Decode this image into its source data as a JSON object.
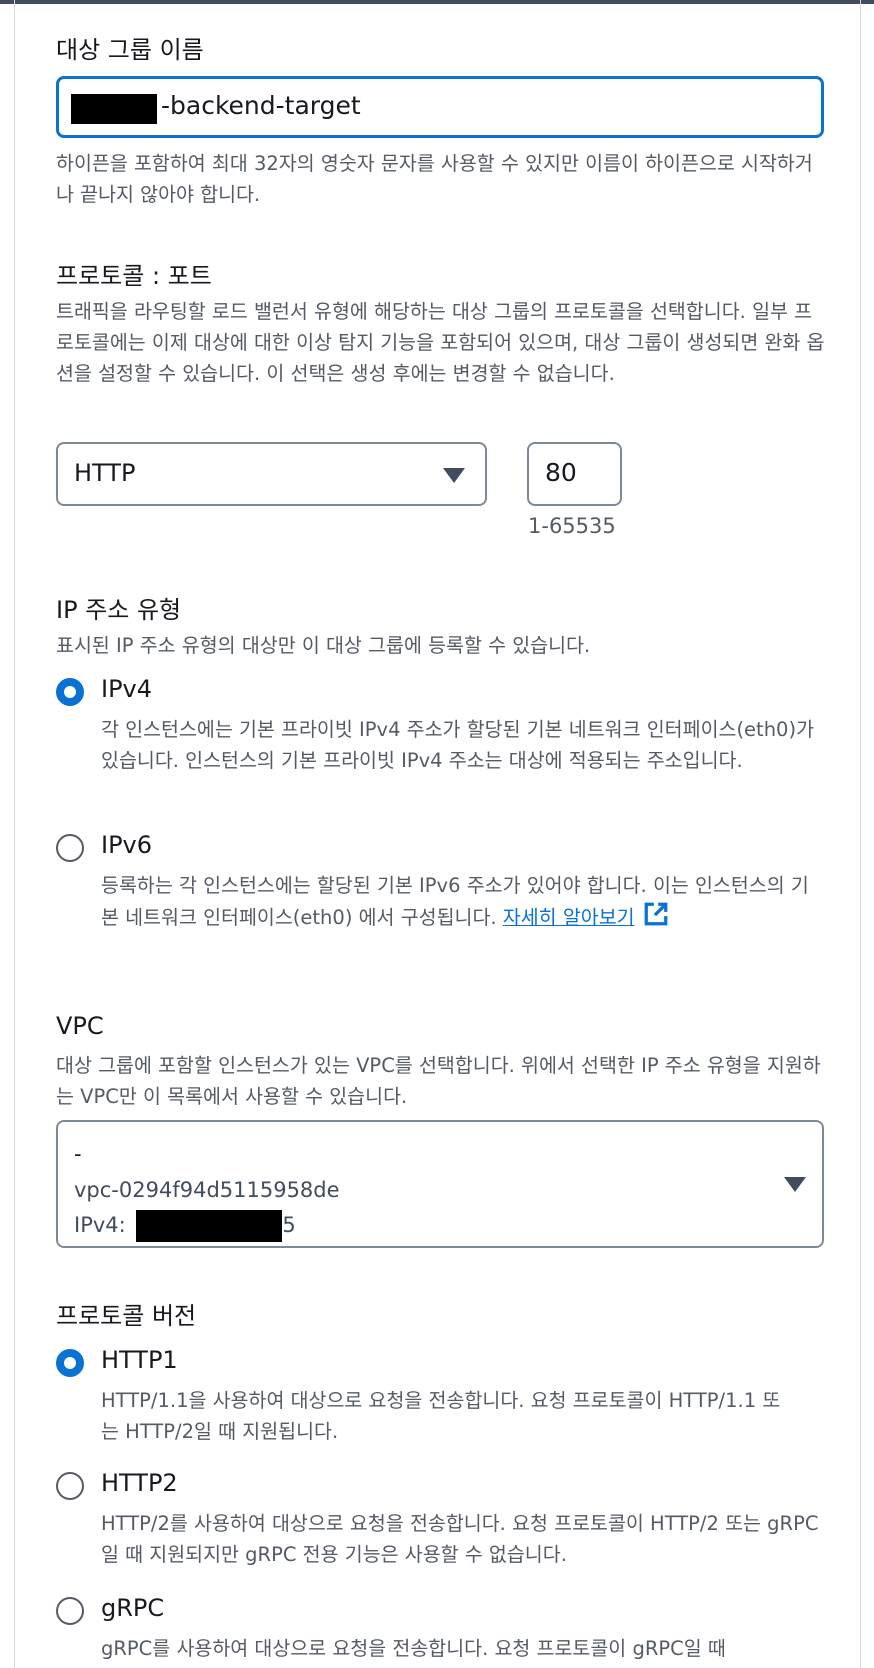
{
  "target_group_name": {
    "label": "대상 그룹 이름",
    "value": "-backend-target",
    "help": "하이픈을 포함하여 최대 32자의 영숫자 문자를 사용할 수 있지만 이름이 하이픈으로 시작하거나 끝나지 않아야 합니다."
  },
  "protocol_port": {
    "label": "프로토콜 : 포트",
    "description": "트래픽을 라우팅할 로드 밸런서 유형에 해당하는 대상 그룹의 프로토콜을 선택합니다. 일부 프로토콜에는 이제 대상에 대한 이상 탐지 기능을 포함되어 있으며, 대상 그룹이 생성되면 완화 옵션을 설정할 수 있습니다. 이 선택은 생성 후에는 변경할 수 없습니다.",
    "protocol": "HTTP",
    "port": "80",
    "port_hint": "1-65535"
  },
  "ip_address_type": {
    "label": "IP 주소 유형",
    "description": "표시된 IP 주소 유형의 대상만 이 대상 그룹에 등록할 수 있습니다.",
    "options": [
      {
        "label": "IPv4",
        "selected": true,
        "description": "각 인스턴스에는 기본 프라이빗 IPv4 주소가 할당된 기본 네트워크 인터페이스(eth0)가 있습니다. 인스턴스의 기본 프라이빗 IPv4 주소는 대상에 적용되는 주소입니다."
      },
      {
        "label": "IPv6",
        "selected": false,
        "description": "등록하는 각 인스턴스에는 할당된 기본 IPv6 주소가 있어야 합니다. 이는 인스턴스의 기본 네트워크 인터페이스(eth0) 에서 구성됩니다. ",
        "link": "자세히 알아보기"
      }
    ]
  },
  "vpc": {
    "label": "VPC",
    "description": "대상 그룹에 포함할 인스턴스가 있는 VPC를 선택합니다. 위에서 선택한 IP 주소 유형을 지원하는 VPC만 이 목록에서 사용할 수 있습니다.",
    "selected_name": "-",
    "selected_id": "vpc-0294f94d5115958de",
    "selected_cidr_prefix": "IPv4: ",
    "selected_cidr_suffix": "5"
  },
  "protocol_version": {
    "label": "프로토콜 버전",
    "options": [
      {
        "label": "HTTP1",
        "selected": true,
        "description": "HTTP/1.1을 사용하여 대상으로 요청을 전송합니다. 요청 프로토콜이 HTTP/1.1 또는 HTTP/2일 때 지원됩니다."
      },
      {
        "label": "HTTP2",
        "selected": false,
        "description": "HTTP/2를 사용하여 대상으로 요청을 전송합니다. 요청 프로토콜이 HTTP/2 또는 gRPC일 때 지원되지만 gRPC 전용 기능은 사용할 수 없습니다."
      },
      {
        "label": "gRPC",
        "selected": false,
        "description": "gRPC를 사용하여 대상으로 요청을 전송합니다. 요청 프로토콜이 gRPC일 때"
      }
    ]
  },
  "colors": {
    "accent": "#0972d3",
    "text": "#16191f",
    "secondary_text": "#545b64",
    "border": "#7d8998"
  },
  "icons": [
    "caret-down-icon",
    "external-link-icon"
  ]
}
